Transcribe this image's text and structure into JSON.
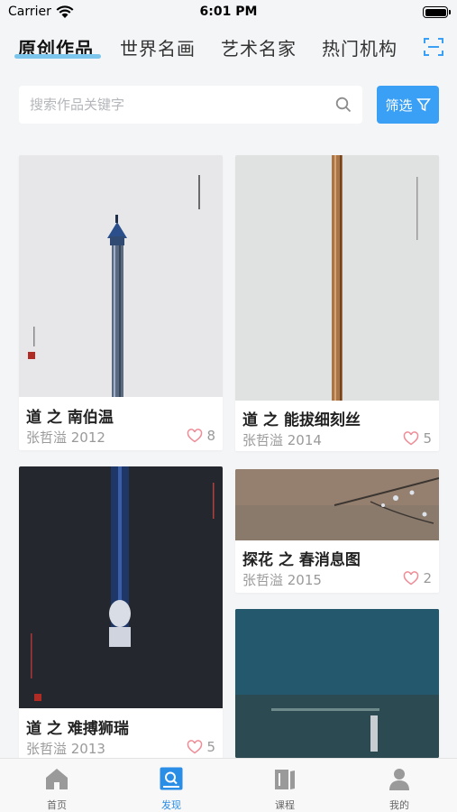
{
  "status_bar": {
    "carrier": "Carrier",
    "time": "6:01 PM"
  },
  "top_tabs": [
    "原创作品",
    "世界名画",
    "艺术名家",
    "热门机构"
  ],
  "search": {
    "placeholder": "搜索作品关键字"
  },
  "filter_label": "筛选",
  "artworks": [
    {
      "title": "道 之 南伯温",
      "artist_year": "张哲溢 2012",
      "likes": "8"
    },
    {
      "title": "道 之 能拔细刻丝",
      "artist_year": "张哲溢 2014",
      "likes": "5"
    },
    {
      "title": "道 之 难搏狮瑞",
      "artist_year": "张哲溢 2013",
      "likes": "5"
    },
    {
      "title": "探花 之 春消息图",
      "artist_year": "张哲溢 2015",
      "likes": "2"
    },
    {
      "title": "",
      "artist_year": "",
      "likes": ""
    }
  ],
  "tabbar": [
    {
      "label": "首页",
      "icon": "home-icon"
    },
    {
      "label": "发现",
      "icon": "discover-icon",
      "active": true
    },
    {
      "label": "课程",
      "icon": "book-icon"
    },
    {
      "label": "我的",
      "icon": "user-icon"
    }
  ],
  "colors": {
    "accent": "#3aa0f5",
    "tab_active": "#2a8de6",
    "underline": "#7cc6ee",
    "background": "#f4f5f7"
  }
}
